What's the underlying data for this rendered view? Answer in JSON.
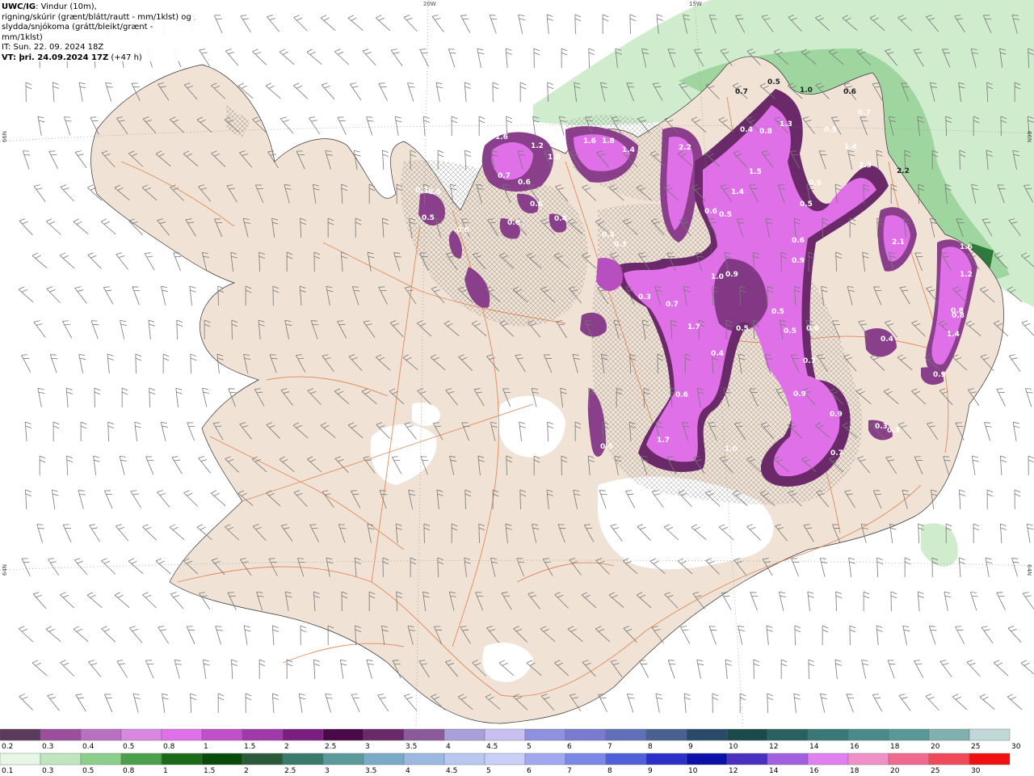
{
  "title": {
    "line1_bold": "UWC/IG",
    "line1_rest": ": Vindur (10m),",
    "line2": "rigning/skúrir (grænt/blátt/rautt - mm/1klst) og",
    "line3": "slydda/snjókoma (grátt/bleikt/grænt - mm/1klst)",
    "line4": "IT: Sun. 22. 09. 2024 18Z",
    "line5_bold": "VT: þri. 24.09.2024 17Z",
    "line5_rest": " (+47 h)"
  },
  "grid_labels": {
    "lon_20w": "20W",
    "lon_15w": "15W",
    "lat_66n_left": "66N",
    "lat_66n_right": "66N",
    "lat_64n_left": "64N",
    "lat_64n_right": "64N"
  },
  "colors": {
    "land": "#f0e2d5",
    "sea": "#ffffff",
    "roads": "#e07a45",
    "rain_light": "#cfeccd",
    "rain_mid": "#9fd69f",
    "rain_dark": "#4fa05a",
    "snow_1": "#5a2f5a",
    "snow_2": "#8a3f8a",
    "snow_3": "#b84fc0",
    "snow_4": "#e070e8",
    "glacier": "#ffffff"
  },
  "precip_labels": [
    {
      "v": "0.7"
    },
    {
      "v": "0.5"
    },
    {
      "v": "1.0"
    },
    {
      "v": "0.6"
    },
    {
      "v": "0.7"
    },
    {
      "v": "1.3"
    },
    {
      "v": "0.8"
    },
    {
      "v": "0.5"
    },
    {
      "v": "1.6"
    },
    {
      "v": "1.2"
    },
    {
      "v": "1.6"
    },
    {
      "v": "1.8"
    },
    {
      "v": "1.4"
    },
    {
      "v": "2.2"
    },
    {
      "v": "1.5"
    },
    {
      "v": "1.4"
    },
    {
      "v": "2.3"
    },
    {
      "v": "1.4"
    },
    {
      "v": "2.2"
    },
    {
      "v": "1.0"
    },
    {
      "v": "0.7"
    },
    {
      "v": "0.6"
    },
    {
      "v": "0.4"
    },
    {
      "v": "0.9"
    },
    {
      "v": "0.5"
    },
    {
      "v": "0.6"
    },
    {
      "v": "0.9"
    },
    {
      "v": "0.6"
    },
    {
      "v": "0.5"
    },
    {
      "v": "0.3"
    },
    {
      "v": "0.5"
    },
    {
      "v": "0.4"
    },
    {
      "v": "0.6"
    },
    {
      "v": "0.6"
    },
    {
      "v": "2.1"
    },
    {
      "v": "1.0"
    },
    {
      "v": "0.9"
    },
    {
      "v": "0.5"
    },
    {
      "v": "0.6"
    },
    {
      "v": "0.3"
    },
    {
      "v": "0.7"
    },
    {
      "v": "1.6"
    },
    {
      "v": "1.2"
    },
    {
      "v": "0.8"
    },
    {
      "v": "1.4"
    },
    {
      "v": "0.8"
    },
    {
      "v": "0.5"
    },
    {
      "v": "0.5"
    },
    {
      "v": "0.5"
    },
    {
      "v": "0.6"
    },
    {
      "v": "1.7"
    },
    {
      "v": "0.4"
    },
    {
      "v": "0.7"
    },
    {
      "v": "0.9"
    },
    {
      "v": "0.4"
    },
    {
      "v": "0.6"
    },
    {
      "v": "0.3"
    },
    {
      "v": "0.5"
    },
    {
      "v": "1.7"
    },
    {
      "v": "1.0"
    },
    {
      "v": "0.9"
    },
    {
      "v": "0.3"
    },
    {
      "v": "0.3"
    },
    {
      "v": "0.7"
    },
    {
      "v": "0.9"
    },
    {
      "v": "0.5"
    }
  ],
  "legend_snow": {
    "labels": [
      "0.2",
      "0.3",
      "0.4",
      "0.5",
      "0.8",
      "1",
      "1.5",
      "2",
      "2.5",
      "3",
      "3.5",
      "4",
      "4.5",
      "5",
      "6",
      "7",
      "8",
      "9",
      "10",
      "12",
      "14",
      "16",
      "18",
      "20",
      "25",
      "30"
    ],
    "colors": [
      "#5b3a5b",
      "#9b4f9b",
      "#b870c0",
      "#d888e0",
      "#e070e8",
      "#c050c8",
      "#a03aa8",
      "#7a1f80",
      "#4a0a4a",
      "#6a2a6a",
      "#8a5a9a",
      "#a8a0d8",
      "#c8c0f0",
      "#9090e0",
      "#7a7ad0",
      "#6070b8",
      "#4a6090",
      "#2a4a6a",
      "#1a4a4a",
      "#2a6060",
      "#3a7878",
      "#4a8a8a",
      "#5a9898",
      "#80b0b0",
      "#c0d8d8"
    ]
  },
  "legend_rain": {
    "labels": [
      "0.1",
      "0.3",
      "0.5",
      "0.8",
      "1",
      "1.5",
      "2",
      "2.5",
      "3",
      "3.5",
      "4",
      "4.5",
      "5",
      "6",
      "7",
      "8",
      "9",
      "10",
      "12",
      "14",
      "16",
      "18",
      "20",
      "25",
      "30"
    ],
    "colors": [
      "#e6f7e6",
      "#c0e6c0",
      "#8ccf8c",
      "#4ca04c",
      "#1a6a1a",
      "#0a4a0a",
      "#2a5a3a",
      "#3a7a6a",
      "#5a9a9a",
      "#7aaac8",
      "#9ab8e0",
      "#b8c8f0",
      "#c8d0f8",
      "#a0a8f0",
      "#7a88e8",
      "#5060d8",
      "#2a30c8",
      "#0a10a8",
      "#4a30c0",
      "#a060e0",
      "#e080f0",
      "#f090c8",
      "#f06a90",
      "#f04a5a",
      "#f01010"
    ]
  }
}
